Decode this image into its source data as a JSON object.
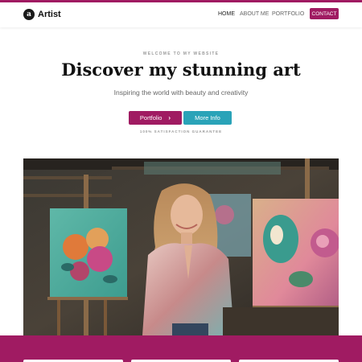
{
  "brand": {
    "logo_letter": "a",
    "name": "Artist"
  },
  "nav": {
    "items": [
      {
        "label": "HOME",
        "active": true
      },
      {
        "label": "ABOUT ME",
        "active": false
      },
      {
        "label": "PORTFOLIO",
        "active": false
      }
    ],
    "contact_label": "CONTACT"
  },
  "hero": {
    "eyebrow": "WELCOME TO MY WEBSITE",
    "title": "Discover my stunning art",
    "subtitle": "Inspiring the world with beauty and creativity",
    "primary_button": "Portfolio",
    "primary_button_icon": "chevron-right-icon",
    "secondary_button": "More Info",
    "guarantee": "100% SATISFACTION GUARANTEE"
  },
  "colors": {
    "accent": "#a01b62",
    "secondary": "#2aa3b8"
  }
}
